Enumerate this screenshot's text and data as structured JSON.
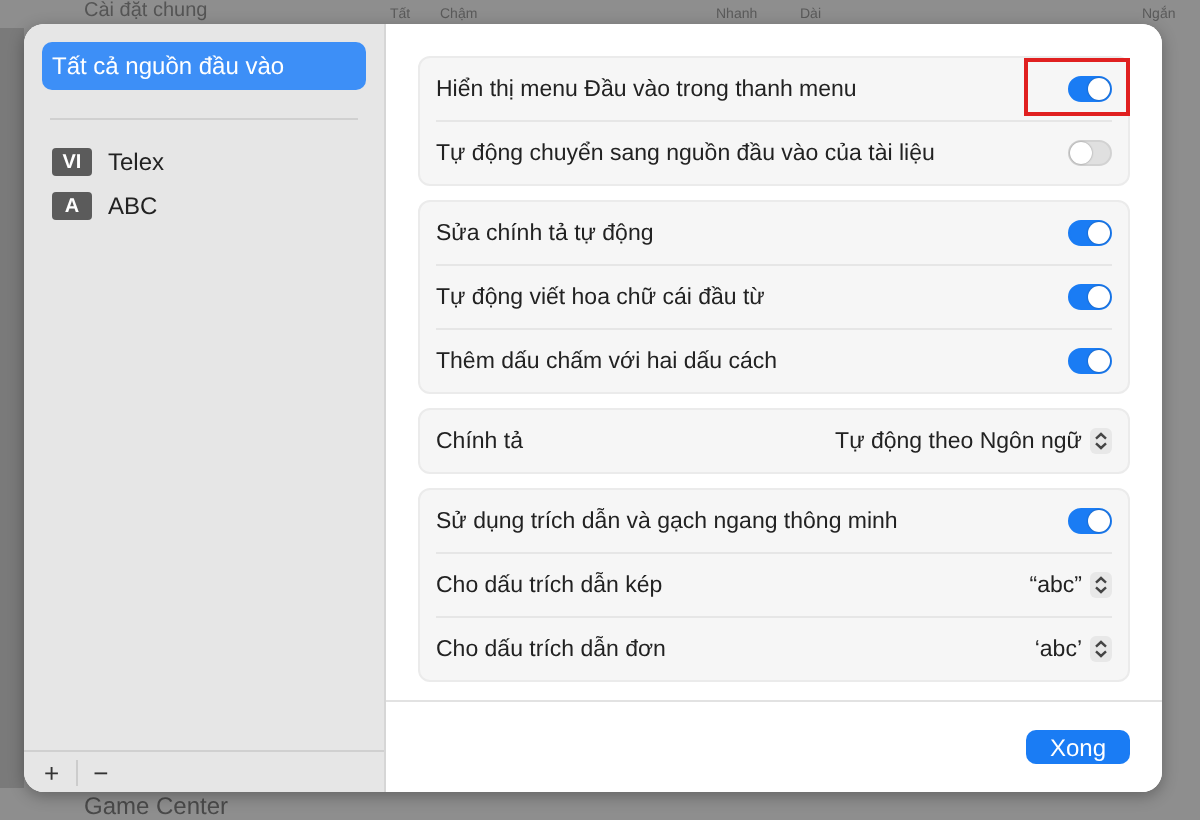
{
  "backdrop": {
    "title": "Cài đặt chung",
    "scale_labels": [
      "Tất",
      "Chậm",
      "Nhanh",
      "Dài",
      "Ngắn"
    ],
    "footer_item": "Game Center"
  },
  "sidebar": {
    "items": [
      {
        "label": "Tất cả nguồn đầu vào",
        "selected": true
      },
      {
        "badge": "VI",
        "label": "Telex",
        "selected": false
      },
      {
        "badge": "A",
        "label": "ABC",
        "selected": false
      }
    ],
    "add_button": "+",
    "remove_button": "−"
  },
  "groups": [
    {
      "rows": [
        {
          "kind": "toggle",
          "label": "Hiển thị menu Đầu vào trong thanh menu",
          "on": true,
          "highlighted": true
        },
        {
          "kind": "toggle",
          "label": "Tự động chuyển sang nguồn đầu vào của tài liệu",
          "on": false,
          "highlighted": false
        }
      ]
    },
    {
      "rows": [
        {
          "kind": "toggle",
          "label": "Sửa chính tả tự động",
          "on": true,
          "highlighted": false
        },
        {
          "kind": "toggle",
          "label": "Tự động viết hoa chữ cái đầu từ",
          "on": true,
          "highlighted": false
        },
        {
          "kind": "toggle",
          "label": "Thêm dấu chấm với hai dấu cách",
          "on": true,
          "highlighted": false
        }
      ]
    },
    {
      "rows": [
        {
          "kind": "popup",
          "label": "Chính tả",
          "value": "Tự động theo Ngôn ngữ",
          "highlighted": false
        }
      ]
    },
    {
      "rows": [
        {
          "kind": "toggle",
          "label": "Sử dụng trích dẫn và gạch ngang thông minh",
          "on": true,
          "highlighted": false
        },
        {
          "kind": "popup",
          "label": "Cho dấu trích dẫn kép",
          "value": "“abc”",
          "highlighted": false
        },
        {
          "kind": "popup",
          "label": "Cho dấu trích dẫn đơn",
          "value": "‘abc’",
          "highlighted": false
        }
      ]
    }
  ],
  "done_button": "Xong"
}
